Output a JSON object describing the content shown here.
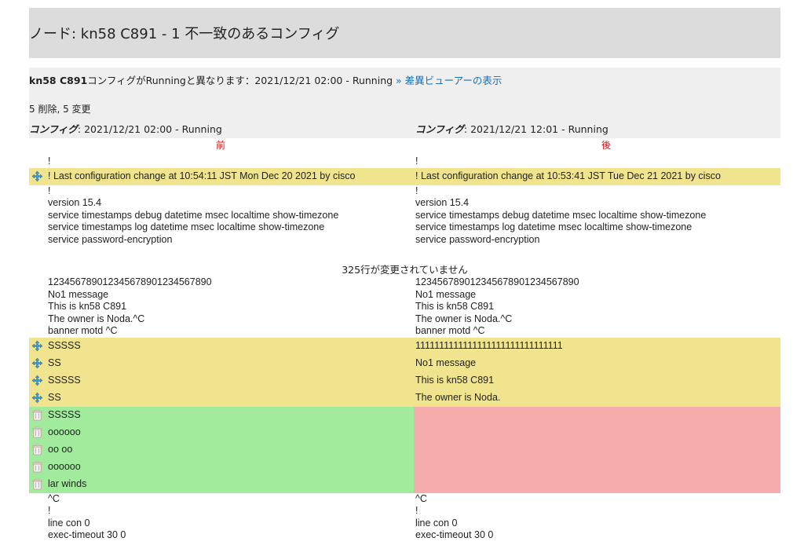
{
  "title": "ノード: kn58 C891 - 1 不一致のあるコンフィグ",
  "info": {
    "node": "kn58 C891",
    "message": "コンフィグがRunningと異なります：2021/12/21 02:00 - Running",
    "link": "» 差異ビューアーの表示",
    "summary": "5 削除, 5 変更"
  },
  "columns": {
    "left": {
      "label": "コンフィグ",
      "value": ": 2021/12/21 02:00 - Running",
      "side": "前"
    },
    "right": {
      "label": "コンフィグ",
      "value": ": 2021/12/21 12:01 - Running",
      "side": "後"
    }
  },
  "unchanged_notice": "325行が変更されていません",
  "icons": {
    "modified": "move-arrows-icon",
    "deleted": "trash-icon"
  },
  "colors": {
    "modified": "#f0e48e",
    "deleted_before": "#a2eb9c",
    "deleted_after": "#f6abac",
    "side_label": "#e01010",
    "link": "#1a6fb4"
  },
  "block1": {
    "rows": [
      {
        "kind": "same",
        "left": "!",
        "right": "!"
      },
      {
        "kind": "mod",
        "left": "! Last configuration change at 10:54:11 JST Mon Dec 20 2021 by cisco",
        "right": "! Last configuration change at 10:53:41 JST Tue Dec 21 2021 by cisco"
      },
      {
        "kind": "same",
        "left": "!",
        "right": "!"
      },
      {
        "kind": "same",
        "left": "version 15.4",
        "right": "version 15.4"
      },
      {
        "kind": "same",
        "left": "service timestamps debug datetime msec localtime show-timezone",
        "right": "service timestamps debug datetime msec localtime show-timezone"
      },
      {
        "kind": "same",
        "left": "service timestamps log datetime msec localtime show-timezone",
        "right": "service timestamps log datetime msec localtime show-timezone"
      },
      {
        "kind": "same",
        "left": "service password-encryption",
        "right": "service password-encryption"
      }
    ]
  },
  "block2": {
    "rows": [
      {
        "kind": "same",
        "left": "12345678901234567890123456789​0",
        "right": "1234567890123456789012345678​90"
      },
      {
        "kind": "same",
        "left": "No1 message",
        "right": "No1 message"
      },
      {
        "kind": "same",
        "left": "This is kn58 C891",
        "right": "This is kn58 C891"
      },
      {
        "kind": "same",
        "left": "The owner is Noda.^C",
        "right": "The owner is Noda.^C"
      },
      {
        "kind": "same",
        "left": "banner motd ^C",
        "right": "banner motd ^C"
      },
      {
        "kind": "mod",
        "left": "SSSSS",
        "right": "1111111111111111111111111111111"
      },
      {
        "kind": "mod",
        "left": "SS",
        "right": "No1 message"
      },
      {
        "kind": "mod",
        "left": "SSSSS",
        "right": "This is kn58 C891"
      },
      {
        "kind": "mod",
        "left": "SS",
        "right": "The owner is Noda."
      },
      {
        "kind": "del",
        "left": "SSSSS",
        "right": ""
      },
      {
        "kind": "del",
        "left": "oooooo",
        "right": ""
      },
      {
        "kind": "del",
        "left": "oo oo",
        "right": ""
      },
      {
        "kind": "del",
        "left": "oooooo",
        "right": ""
      },
      {
        "kind": "del",
        "left": "lar winds",
        "right": ""
      },
      {
        "kind": "same",
        "left": "^C",
        "right": "^C"
      },
      {
        "kind": "same",
        "left": "!",
        "right": "!"
      },
      {
        "kind": "same",
        "left": "line con 0",
        "right": "line con 0"
      },
      {
        "kind": "same",
        "left": "exec-timeout 30 0",
        "right": "exec-timeout 30 0"
      }
    ]
  }
}
